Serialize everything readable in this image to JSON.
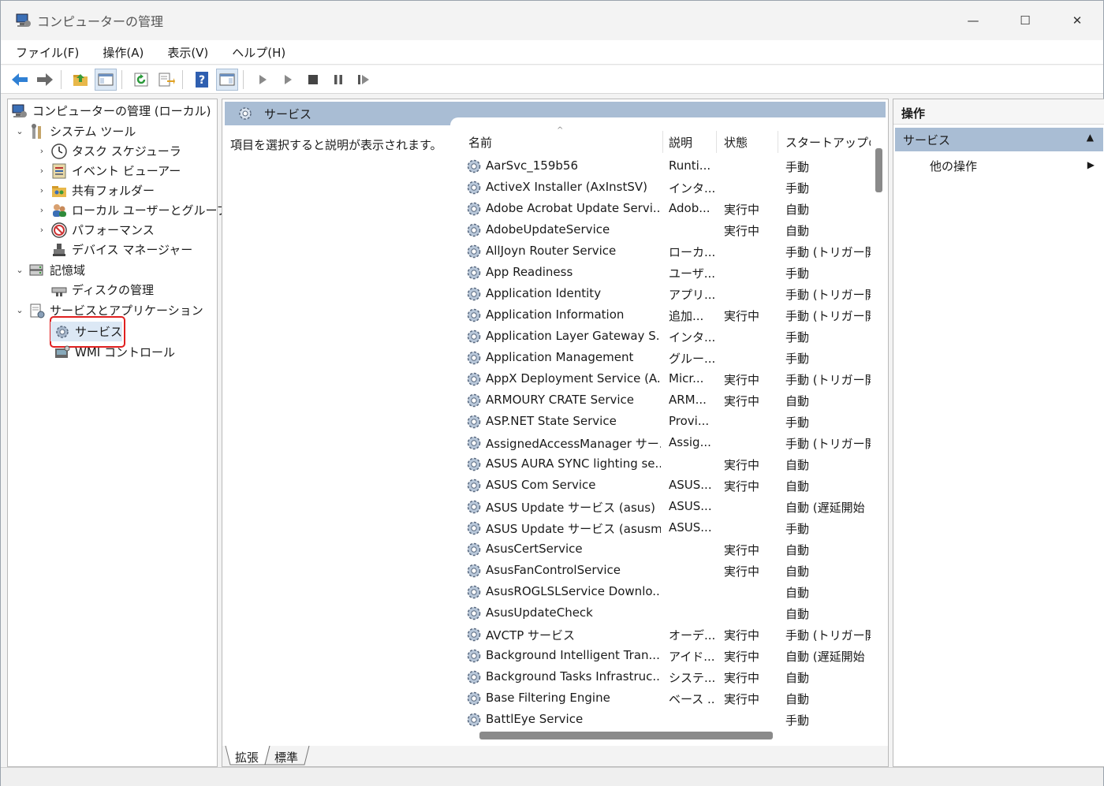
{
  "window": {
    "title": "コンピューターの管理",
    "minimize_glyph": "—",
    "maximize_glyph": "☐",
    "close_glyph": "✕"
  },
  "menu": [
    "ファイル(F)",
    "操作(A)",
    "表示(V)",
    "ヘルプ(H)"
  ],
  "tree": {
    "root": "コンピューターの管理 (ローカル)",
    "system_tools": "システム ツール",
    "task_scheduler": "タスク スケジューラ",
    "event_viewer": "イベント ビューアー",
    "shared_folders": "共有フォルダー",
    "local_users": "ローカル ユーザーとグループ",
    "performance": "パフォーマンス",
    "device_manager": "デバイス マネージャー",
    "storage": "記憶域",
    "disk_management": "ディスクの管理",
    "services_apps": "サービスとアプリケーション",
    "services": "サービス",
    "wmi": "WMI コントロール"
  },
  "center": {
    "header": "サービス",
    "description": "項目を選択すると説明が表示されます。",
    "columns": {
      "name": "名前",
      "desc": "説明",
      "status": "状態",
      "startup": "スタートアップの種"
    },
    "sort_glyph": "^",
    "tabs": [
      "拡張",
      "標準"
    ]
  },
  "services": [
    {
      "name": "AarSvc_159b56",
      "desc": "Runti...",
      "status": "",
      "startup": "手動"
    },
    {
      "name": "ActiveX Installer (AxInstSV)",
      "desc": "インタ...",
      "status": "",
      "startup": "手動"
    },
    {
      "name": "Adobe Acrobat Update Servi...",
      "desc": "Adob...",
      "status": "実行中",
      "startup": "自動"
    },
    {
      "name": "AdobeUpdateService",
      "desc": "",
      "status": "実行中",
      "startup": "自動"
    },
    {
      "name": "AllJoyn Router Service",
      "desc": "ローカ...",
      "status": "",
      "startup": "手動 (トリガー開"
    },
    {
      "name": "App Readiness",
      "desc": "ユーザ...",
      "status": "",
      "startup": "手動"
    },
    {
      "name": "Application Identity",
      "desc": "アプリ...",
      "status": "",
      "startup": "手動 (トリガー開"
    },
    {
      "name": "Application Information",
      "desc": "追加...",
      "status": "実行中",
      "startup": "手動 (トリガー開"
    },
    {
      "name": "Application Layer Gateway S...",
      "desc": "インタ...",
      "status": "",
      "startup": "手動"
    },
    {
      "name": "Application Management",
      "desc": "グルー...",
      "status": "",
      "startup": "手動"
    },
    {
      "name": "AppX Deployment Service (A...",
      "desc": "Micr...",
      "status": "実行中",
      "startup": "手動 (トリガー開"
    },
    {
      "name": "ARMOURY CRATE Service",
      "desc": "ARM...",
      "status": "実行中",
      "startup": "自動"
    },
    {
      "name": "ASP.NET State Service",
      "desc": "Provi...",
      "status": "",
      "startup": "手動"
    },
    {
      "name": "AssignedAccessManager サー...",
      "desc": "Assig...",
      "status": "",
      "startup": "手動 (トリガー開"
    },
    {
      "name": "ASUS AURA SYNC lighting se...",
      "desc": "",
      "status": "実行中",
      "startup": "自動"
    },
    {
      "name": "ASUS Com Service",
      "desc": "ASUS...",
      "status": "実行中",
      "startup": "自動"
    },
    {
      "name": "ASUS Update サービス (asus)",
      "desc": "ASUS...",
      "status": "",
      "startup": "自動 (遅延開始"
    },
    {
      "name": "ASUS Update サービス (asusm)",
      "desc": "ASUS...",
      "status": "",
      "startup": "手動"
    },
    {
      "name": "AsusCertService",
      "desc": "",
      "status": "実行中",
      "startup": "自動"
    },
    {
      "name": "AsusFanControlService",
      "desc": "",
      "status": "実行中",
      "startup": "自動"
    },
    {
      "name": "AsusROGLSLService Downlo...",
      "desc": "",
      "status": "",
      "startup": "自動"
    },
    {
      "name": "AsusUpdateCheck",
      "desc": "",
      "status": "",
      "startup": "自動"
    },
    {
      "name": "AVCTP サービス",
      "desc": "オーデ...",
      "status": "実行中",
      "startup": "手動 (トリガー開"
    },
    {
      "name": "Background Intelligent Tran...",
      "desc": "アイド...",
      "status": "実行中",
      "startup": "自動 (遅延開始"
    },
    {
      "name": "Background Tasks Infrastruc...",
      "desc": "システ...",
      "status": "実行中",
      "startup": "自動"
    },
    {
      "name": "Base Filtering Engine",
      "desc": "ベース ...",
      "status": "実行中",
      "startup": "自動"
    },
    {
      "name": "BattlEye Service",
      "desc": "",
      "status": "",
      "startup": "手動"
    }
  ],
  "actions": {
    "header": "操作",
    "section": "サービス",
    "collapse_glyph": "▲",
    "other": "他の操作",
    "other_glyph": "▶"
  },
  "colors": {
    "selection_highlight": "#e02020",
    "header_blue": "#a9bdd4"
  }
}
